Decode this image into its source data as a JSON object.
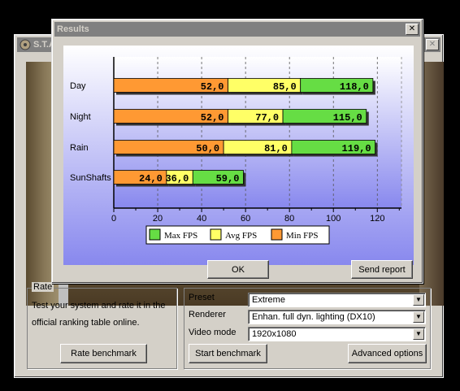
{
  "background_window": {
    "title": "S.T.A",
    "rate_group": {
      "label": "Rate",
      "description": "Test your system and rate it in the official ranking table online.",
      "rate_button": "Rate benchmark"
    },
    "settings": {
      "preset_label": "Preset",
      "preset_value": "Extreme",
      "renderer_label": "Renderer",
      "renderer_value": "Enhan. full dyn. lighting (DX10)",
      "video_mode_label": "Video mode",
      "video_mode_value": "1920x1080",
      "start_button": "Start benchmark",
      "advanced_button": "Advanced options"
    }
  },
  "results_dialog": {
    "title": "Results",
    "close_glyph": "✕",
    "ok_button": "OK",
    "send_report_button": "Send report"
  },
  "chart_data": {
    "type": "bar",
    "stacked": true,
    "orientation": "horizontal",
    "categories": [
      "Day",
      "Night",
      "Rain",
      "SunShafts"
    ],
    "series": [
      {
        "name": "Min FPS",
        "values": [
          52.0,
          52.0,
          50.0,
          24.0
        ],
        "color": "#ff9933"
      },
      {
        "name": "Avg FPS",
        "values": [
          85.0,
          77.0,
          81.0,
          36.0
        ],
        "color": "#ffff66"
      },
      {
        "name": "Max FPS",
        "values": [
          118.0,
          115.0,
          119.0,
          59.0
        ],
        "color": "#66dd44"
      }
    ],
    "value_labels": [
      [
        "52,0",
        "85,0",
        "118,0"
      ],
      [
        "52,0",
        "77,0",
        "115,0"
      ],
      [
        "50,0",
        "81,0",
        "119,0"
      ],
      [
        "24,0",
        "36,0",
        "59,0"
      ]
    ],
    "x_ticks": [
      0,
      20,
      40,
      60,
      80,
      100,
      120
    ],
    "xlim": [
      0,
      131
    ],
    "grid": true,
    "legend": [
      "Max FPS",
      "Avg FPS",
      "Min FPS"
    ],
    "legend_position": "bottom"
  }
}
